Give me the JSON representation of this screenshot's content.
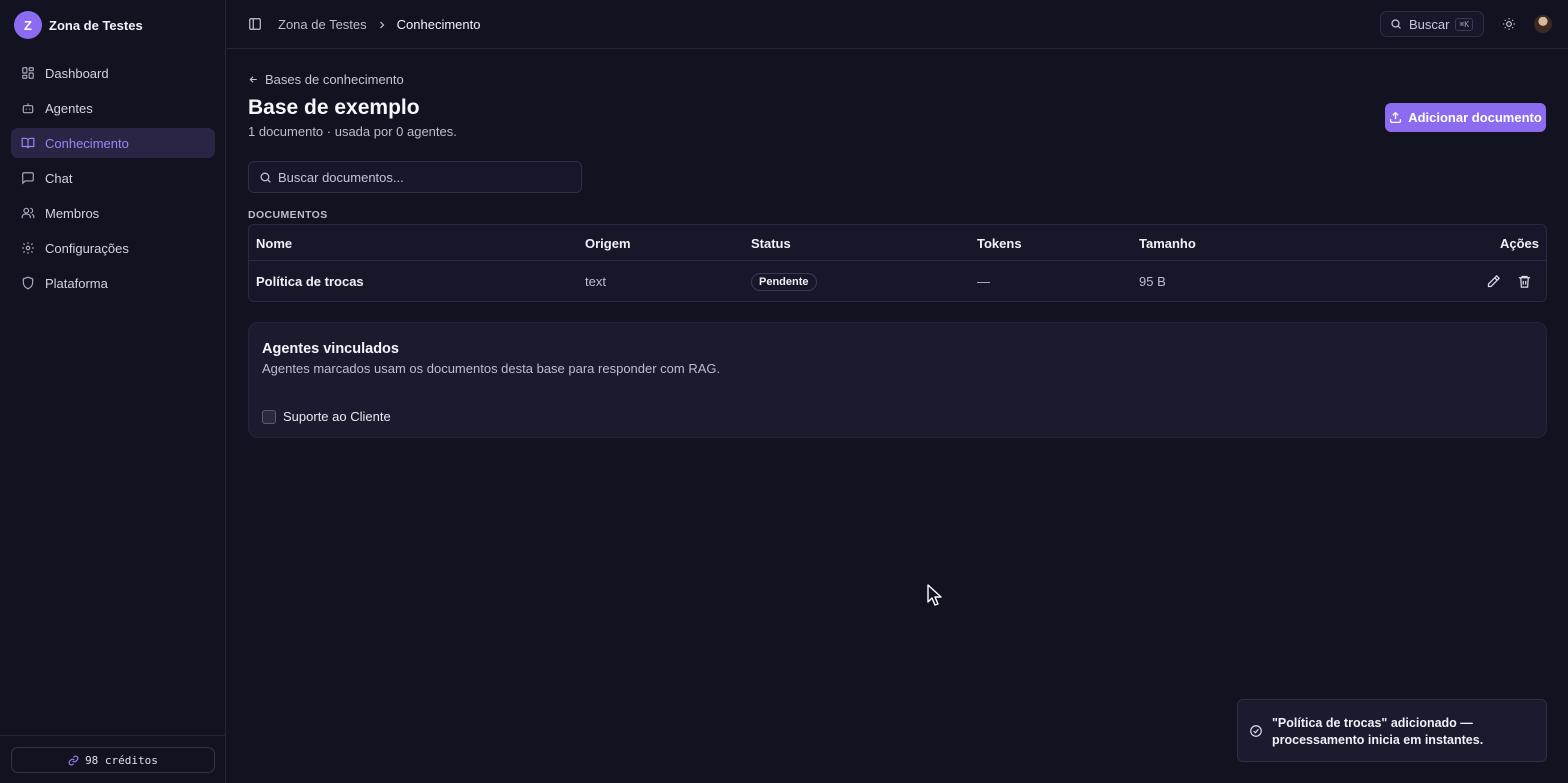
{
  "workspace": {
    "initial": "Z",
    "name": "Zona de Testes"
  },
  "sidebar": {
    "items": [
      {
        "label": "Dashboard",
        "icon": "dashboard-icon"
      },
      {
        "label": "Agentes",
        "icon": "bot-icon"
      },
      {
        "label": "Conhecimento",
        "icon": "book-open-icon",
        "active": true
      },
      {
        "label": "Chat",
        "icon": "chat-icon"
      },
      {
        "label": "Membros",
        "icon": "users-icon"
      },
      {
        "label": "Configurações",
        "icon": "gear-icon"
      },
      {
        "label": "Plataforma",
        "icon": "shield-icon"
      }
    ],
    "credits": "98 créditos"
  },
  "topbar": {
    "breadcrumb": [
      "Zona de Testes",
      "Conhecimento"
    ],
    "search_label": "Buscar",
    "search_shortcut": "⌘K"
  },
  "page": {
    "back_label": "Bases de conhecimento",
    "title": "Base de exemplo",
    "subtitle": "1 documento · usada por 0 agentes.",
    "add_button": "Adicionar documento",
    "search_placeholder": "Buscar documentos...",
    "section_label": "DOCUMENTOS"
  },
  "table": {
    "headers": [
      "Nome",
      "Origem",
      "Status",
      "Tokens",
      "Tamanho",
      "Ações"
    ],
    "rows": [
      {
        "name": "Política de trocas",
        "origin": "text",
        "status": "Pendente",
        "tokens": "—",
        "size": "95 B"
      }
    ]
  },
  "linked_agents": {
    "title": "Agentes vinculados",
    "description": "Agentes marcados usam os documentos desta base para responder com RAG.",
    "agents": [
      {
        "label": "Suporte ao Cliente",
        "checked": false
      }
    ]
  },
  "toast": {
    "message": "\"Política de trocas\" adicionado — processamento inicia em instantes."
  },
  "colors": {
    "background": "#121221",
    "accent": "#8b6cf0",
    "active_nav_bg": "#2a2545",
    "active_nav_text": "#9d84f7"
  }
}
